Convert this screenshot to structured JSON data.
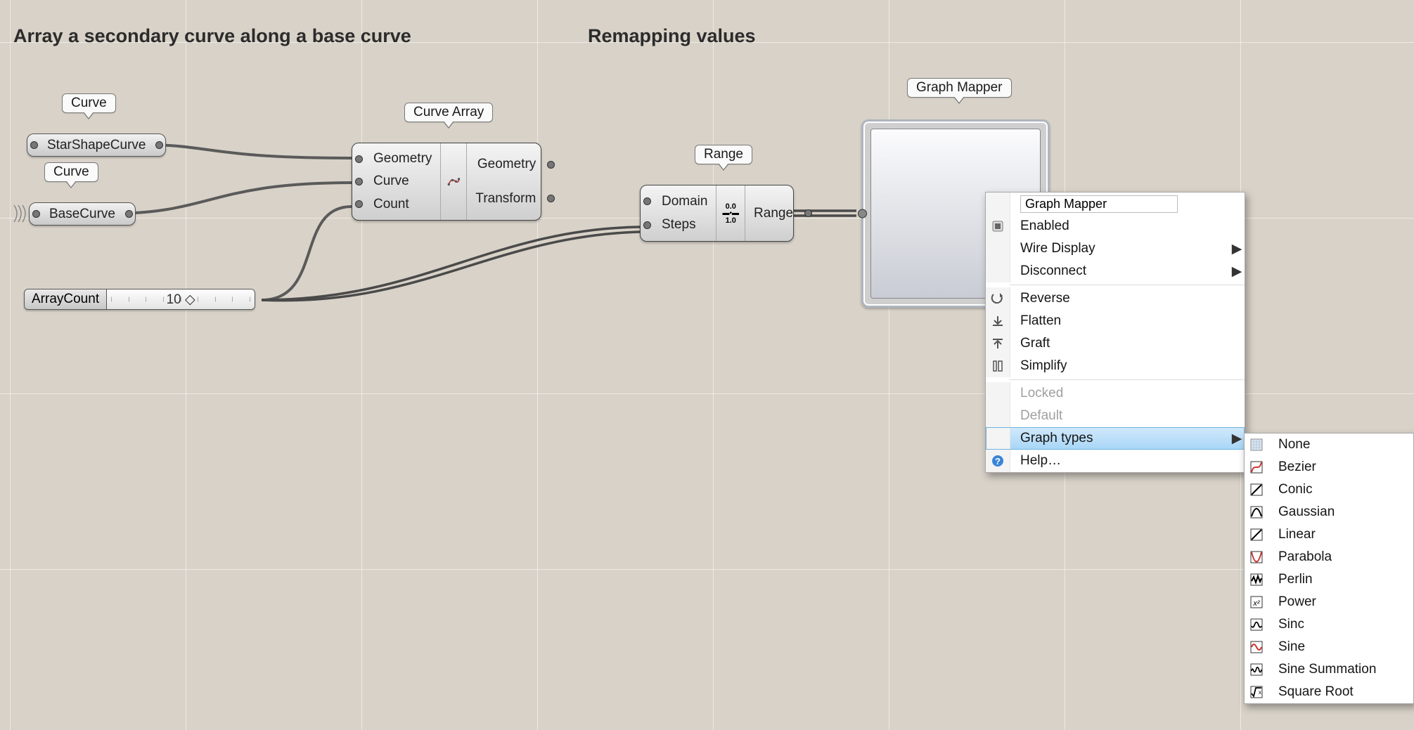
{
  "headings": {
    "left": "Array a secondary curve along a base curve",
    "right": "Remapping values"
  },
  "tags": {
    "curve1": "Curve",
    "curve2": "Curve",
    "curveArray": "Curve Array",
    "range": "Range",
    "graphMapper": "Graph Mapper"
  },
  "params": {
    "starShape": "StarShapeCurve",
    "baseCurve": "BaseCurve"
  },
  "slider": {
    "label": "ArrayCount",
    "value": "10 ◇"
  },
  "curveArrayNode": {
    "inputs": [
      "Geometry",
      "Curve",
      "Count"
    ],
    "outputs": [
      "Geometry",
      "Transform"
    ]
  },
  "rangeNode": {
    "inputs": [
      "Domain",
      "Steps"
    ],
    "outputs": [
      "Range"
    ],
    "iconTop": "0.0",
    "iconBot": "1.0"
  },
  "contextMenu": {
    "titleValue": "Graph Mapper",
    "items": {
      "enabled": "Enabled",
      "wireDisplay": "Wire Display",
      "disconnect": "Disconnect",
      "reverse": "Reverse",
      "flatten": "Flatten",
      "graft": "Graft",
      "simplify": "Simplify",
      "locked": "Locked",
      "default": "Default",
      "graphTypes": "Graph types",
      "help": "Help…"
    }
  },
  "graphTypesSubmenu": {
    "items": [
      "None",
      "Bezier",
      "Conic",
      "Gaussian",
      "Linear",
      "Parabola",
      "Perlin",
      "Power",
      "Sinc",
      "Sine",
      "Sine Summation",
      "Square Root"
    ]
  }
}
